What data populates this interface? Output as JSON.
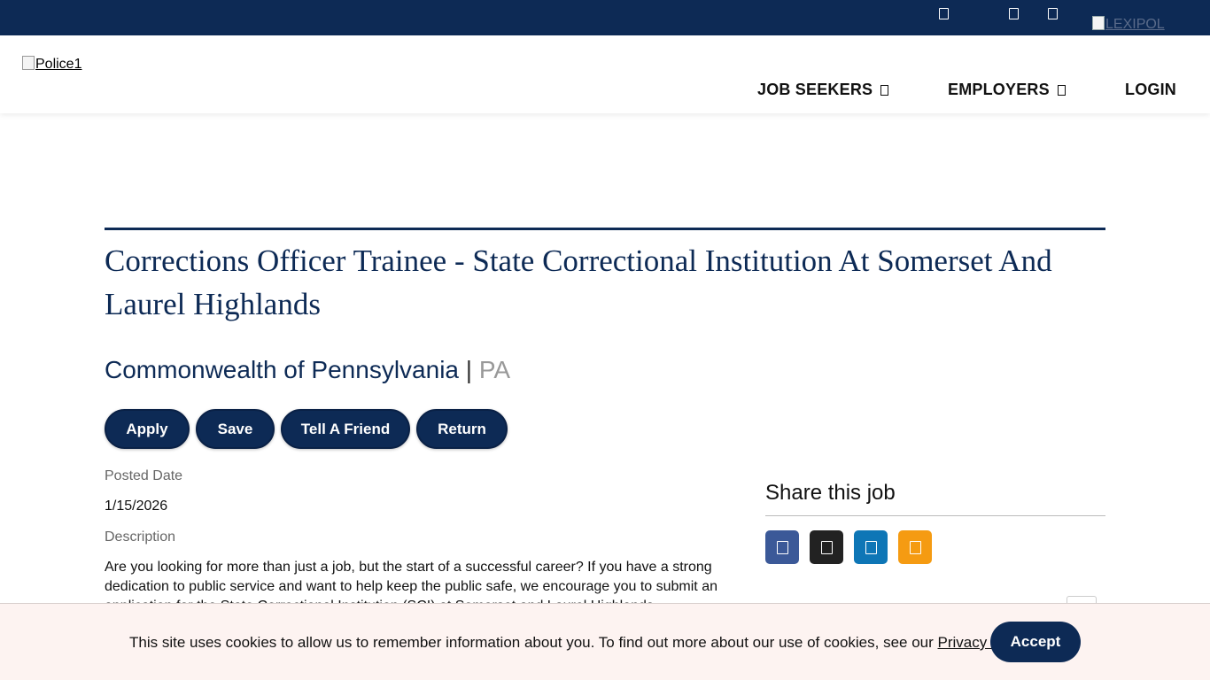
{
  "topbar": {
    "icons": [
      "user-icon",
      "search-icon",
      "menu-icon"
    ],
    "brand_logo_alt": "LEXIPOL",
    "colors": {
      "background": "#0d2a55"
    }
  },
  "header": {
    "logo_alt": "Police1",
    "nav": [
      {
        "label": "JOB SEEKERS",
        "has_dropdown": true
      },
      {
        "label": "EMPLOYERS",
        "has_dropdown": true
      },
      {
        "label": "LOGIN",
        "has_dropdown": false
      }
    ]
  },
  "job": {
    "title": "Corrections Officer Trainee - State Correctional Institution At Somerset And Laurel Highlands",
    "employer": "Commonwealth of Pennsylvania",
    "separator": "|",
    "state": "PA",
    "actions": [
      "Apply",
      "Save",
      "Tell A Friend",
      "Return"
    ],
    "posted_date_label": "Posted Date",
    "posted_date": "1/15/2026",
    "description_label": "Description",
    "description": "Are you looking for more than just a job, but the start of a successful career? If you have a strong dedication to public service and want to help keep the public safe, we encourage you to submit an application for the State Correctional Institution (SCI) at Somerset and Laurel Highlands."
  },
  "share": {
    "title": "Share this job",
    "buttons": [
      {
        "icon": "facebook-icon",
        "color": "#3b5998"
      },
      {
        "icon": "x-icon",
        "color": "#222222"
      },
      {
        "icon": "linkedin-icon",
        "color": "#0e76b6"
      },
      {
        "icon": "email-icon",
        "color": "#f59b12"
      }
    ]
  },
  "cookie_banner": {
    "text": "This site uses cookies to allow us to remember information about you. To find out more about our use of cookies, see our ",
    "link_text": "Privacy Policy",
    "text_end": ".",
    "accept_label": "Accept",
    "background": "#fdf3f1"
  },
  "colors": {
    "brand_navy": "#0d2a55",
    "muted_text": "#999999"
  }
}
